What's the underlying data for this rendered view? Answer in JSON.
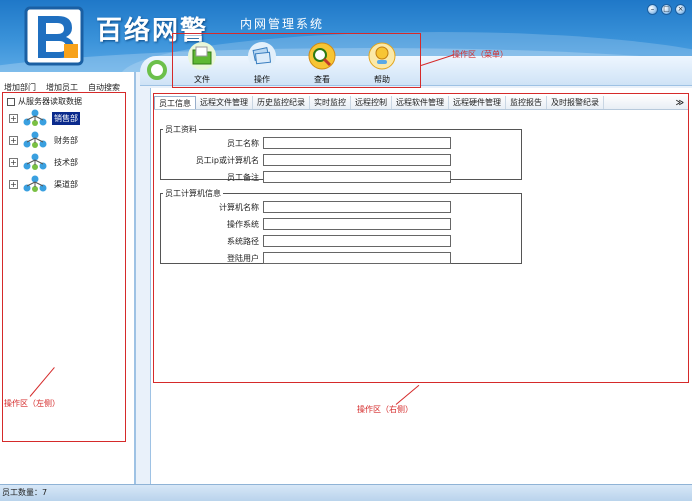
{
  "app": {
    "name": "百络网警",
    "subtitle": "内网管理系统",
    "window_buttons": [
      "–",
      "□",
      "×"
    ]
  },
  "toolbar": {
    "items": [
      {
        "label": "文件",
        "icon": "folder-icon"
      },
      {
        "label": "操作",
        "icon": "stack-icon"
      },
      {
        "label": "查看",
        "icon": "view-icon"
      },
      {
        "label": "帮助",
        "icon": "help-icon"
      }
    ],
    "annotation": "操作区（菜单）"
  },
  "left_panel": {
    "links": [
      "增加部门",
      "增加员工",
      "自动搜索"
    ],
    "load_label": "从服务器读取数据",
    "departments": [
      {
        "label": "销售部",
        "selected": true
      },
      {
        "label": "财务部",
        "selected": false
      },
      {
        "label": "技术部",
        "selected": false
      },
      {
        "label": "渠道部",
        "selected": false
      }
    ],
    "annotation": "操作区（左侧）"
  },
  "right_panel": {
    "tabs": [
      "员工信息",
      "远程文件管理",
      "历史监控纪录",
      "实时监控",
      "远程控制",
      "远程软件管理",
      "远程硬件管理",
      "监控报告",
      "及时报警纪录"
    ],
    "more": "≫",
    "group1": {
      "title": "员工资料",
      "fields": [
        {
          "label": "员工名称",
          "value": ""
        },
        {
          "label": "员工ip或计算机名",
          "value": ""
        },
        {
          "label": "员工备注",
          "value": ""
        }
      ]
    },
    "group2": {
      "title": "员工计算机信息",
      "fields": [
        {
          "label": "计算机名称",
          "value": ""
        },
        {
          "label": "操作系统",
          "value": ""
        },
        {
          "label": "系统路径",
          "value": ""
        },
        {
          "label": "登陆用户",
          "value": ""
        }
      ]
    },
    "annotation": "操作区（右侧）"
  },
  "status": {
    "text": "员工数量：7"
  },
  "colors": {
    "header": "#2a86d2",
    "annotation": "#d52a2a",
    "selected": "#0a2a8c"
  }
}
